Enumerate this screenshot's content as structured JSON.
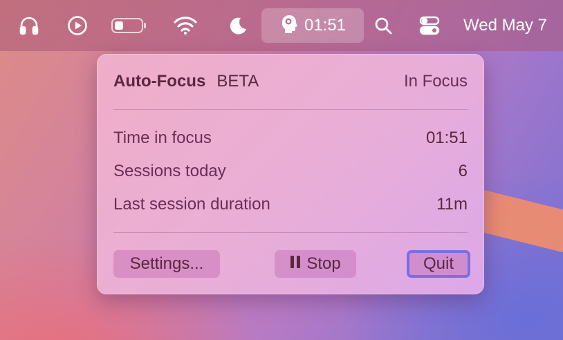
{
  "menubar": {
    "icons": [
      "headphones-icon",
      "play-icon",
      "battery-icon",
      "wifi-icon",
      "moon-icon",
      "search-icon",
      "control-center-icon"
    ],
    "focus_time": "01:51",
    "date": "Wed May 7"
  },
  "popover": {
    "app_name": "Auto-Focus",
    "badge": "BETA",
    "status": "In Focus",
    "stats": [
      {
        "label": "Time in focus",
        "value": "01:51"
      },
      {
        "label": "Sessions today",
        "value": "6"
      },
      {
        "label": "Last session duration",
        "value": "11m"
      }
    ],
    "buttons": {
      "settings": "Settings...",
      "stop": "Stop",
      "quit": "Quit"
    }
  },
  "colors": {
    "accent_focus_ring": "#7b6ee3",
    "text": "#5a2640"
  }
}
